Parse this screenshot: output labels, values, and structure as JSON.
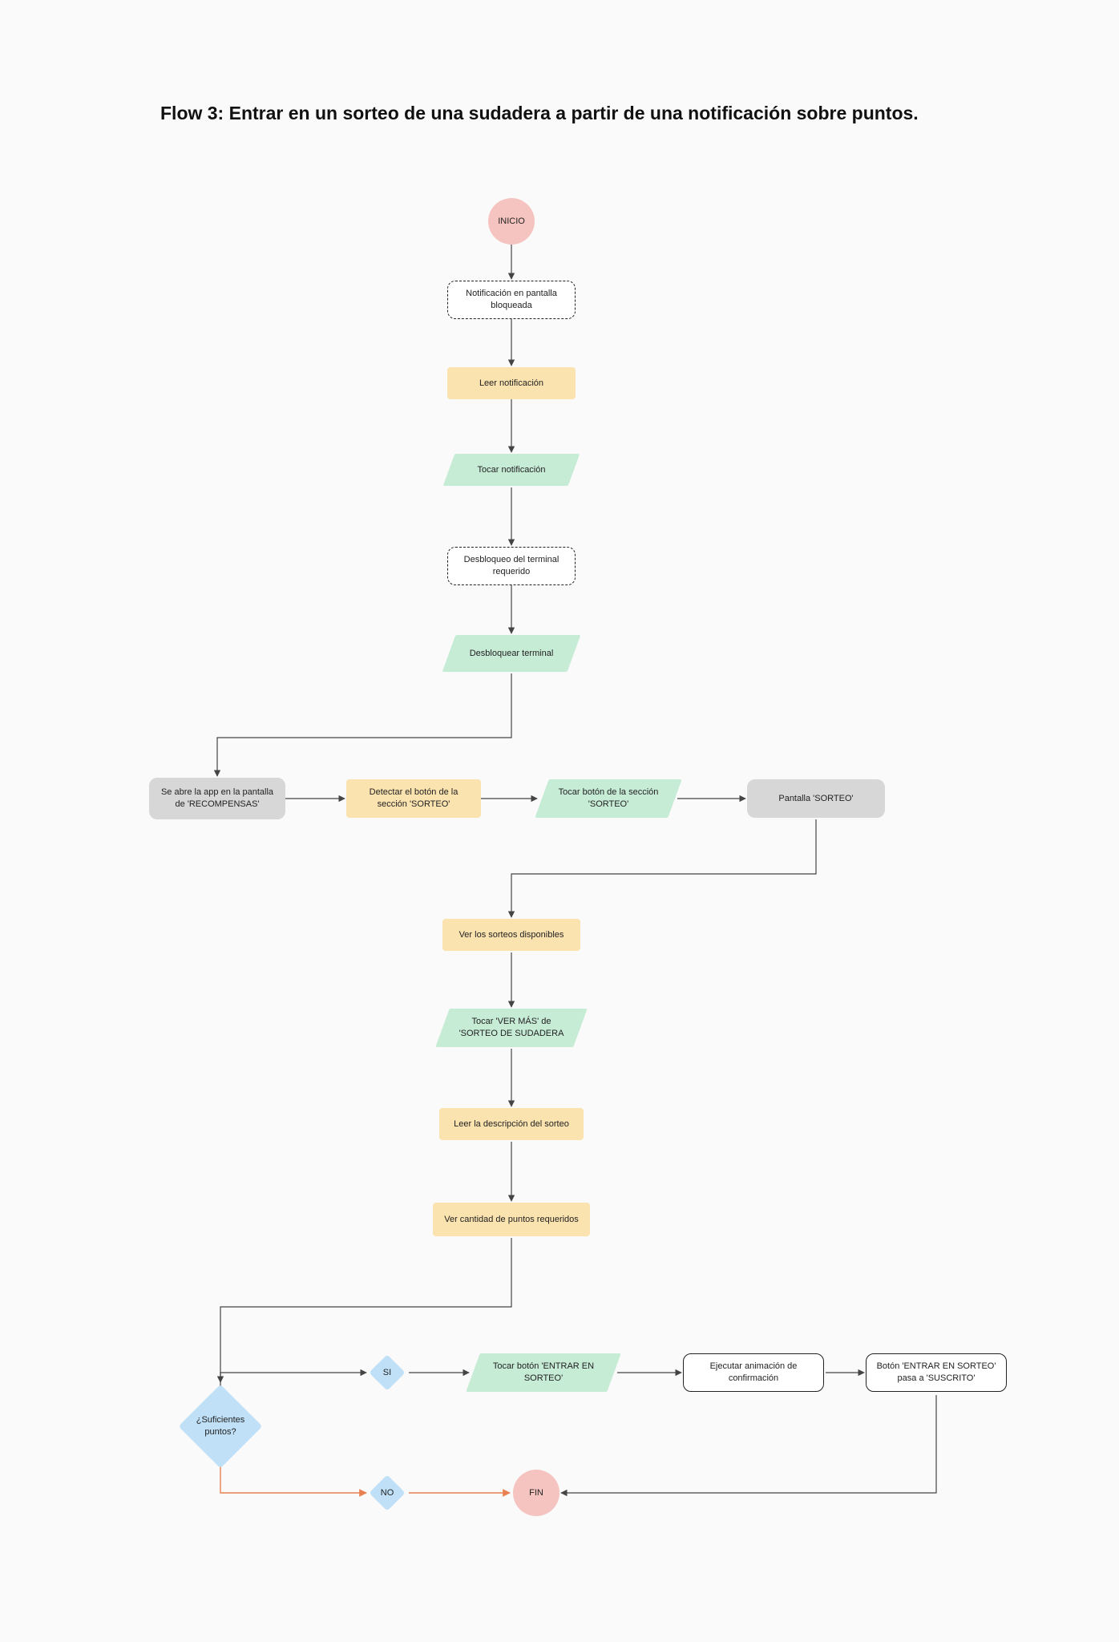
{
  "title": "Flow 3: Entrar en un sorteo de una sudadera a partir de una notificación sobre puntos.",
  "nodes": {
    "inicio": "INICIO",
    "notif_lock": "Notificación en pantalla bloqueada",
    "leer_notif": "Leer notificación",
    "tocar_notif": "Tocar notificación",
    "desbloqueo_req": "Desbloqueo del terminal requerido",
    "desbloquear": "Desbloquear terminal",
    "abre_app": "Se abre la app en la pantalla de 'RECOMPENSAS'",
    "detectar_boton": "Detectar el botón de la sección 'SORTEO'",
    "tocar_boton_sorteo": "Tocar botón de la sección 'SORTEO'",
    "pantalla_sorteo": "Pantalla 'SORTEO'",
    "ver_sorteos": "Ver los sorteos disponibles",
    "tocar_ver_mas": "Tocar 'VER MÁS' de 'SORTEO DE SUDADERA",
    "leer_desc": "Leer la descripción del sorteo",
    "ver_puntos": "Ver cantidad de puntos requeridos",
    "suficientes": "¿Suficientes puntos?",
    "si": "SI",
    "no": "NO",
    "tocar_entrar": "Tocar botón 'ENTRAR EN SORTEO'",
    "ejecutar_anim": "Ejecutar animación de confirmación",
    "boton_suscrito": "Botón 'ENTRAR EN SORTEO' pasa a 'SUSCRITO'",
    "fin": "FIN"
  }
}
